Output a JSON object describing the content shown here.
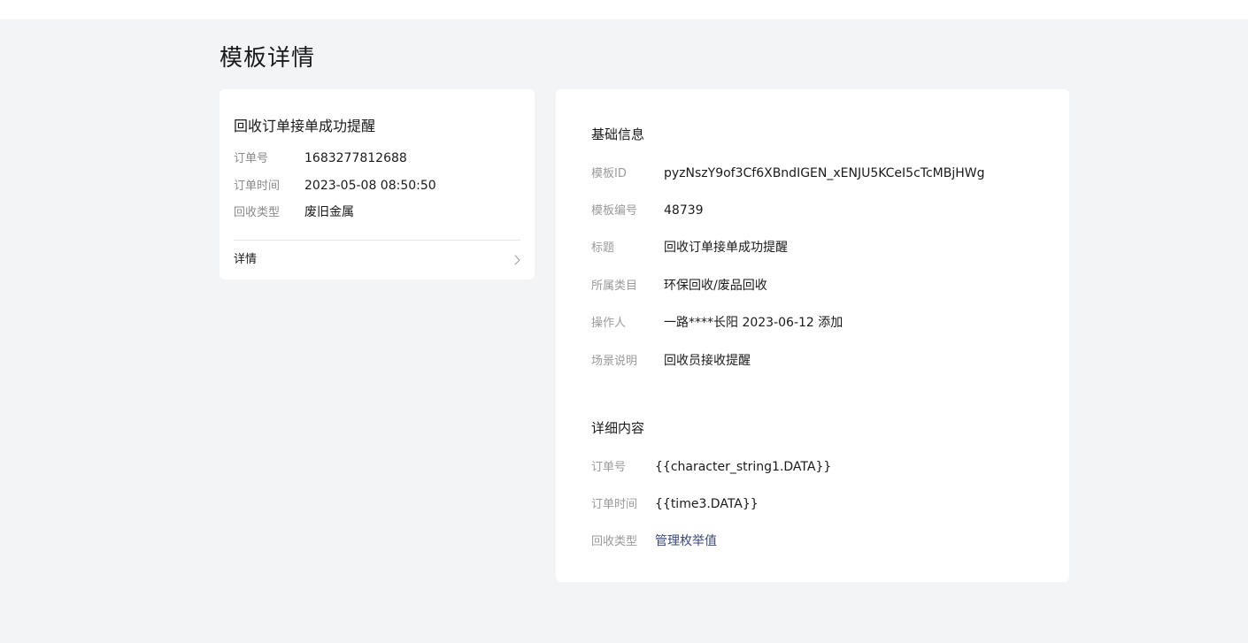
{
  "page": {
    "title": "模板详情"
  },
  "preview": {
    "title": "回收订单接单成功提醒",
    "fields": [
      {
        "label": "订单号",
        "value": "1683277812688"
      },
      {
        "label": "订单时间",
        "value": "2023-05-08 08:50:50"
      },
      {
        "label": "回收类型",
        "value": "废旧金属"
      }
    ],
    "detail_label": "详情"
  },
  "basic_info": {
    "title": "基础信息",
    "fields": [
      {
        "label": "模板ID",
        "value": "pyzNszY9of3Cf6XBndIGEN_xENJU5KCeI5cTcMBjHWg"
      },
      {
        "label": "模板编号",
        "value": "48739"
      },
      {
        "label": "标题",
        "value": "回收订单接单成功提醒"
      },
      {
        "label": "所属类目",
        "value": "环保回收/废品回收"
      },
      {
        "label": "操作人",
        "value": "一路****长阳 2023-06-12 添加"
      },
      {
        "label": "场景说明",
        "value": "回收员接收提醒"
      }
    ]
  },
  "detail_content": {
    "title": "详细内容",
    "fields": [
      {
        "label": "订单号",
        "value": "{{character_string1.DATA}}"
      },
      {
        "label": "订单时间",
        "value": "{{time3.DATA}}"
      },
      {
        "label": "回收类型",
        "value": "管理枚举值"
      }
    ]
  },
  "colors": {
    "background": "#f3f4f6",
    "card": "#ffffff",
    "label": "#9a9a9a",
    "link": "#3a4a7a"
  }
}
